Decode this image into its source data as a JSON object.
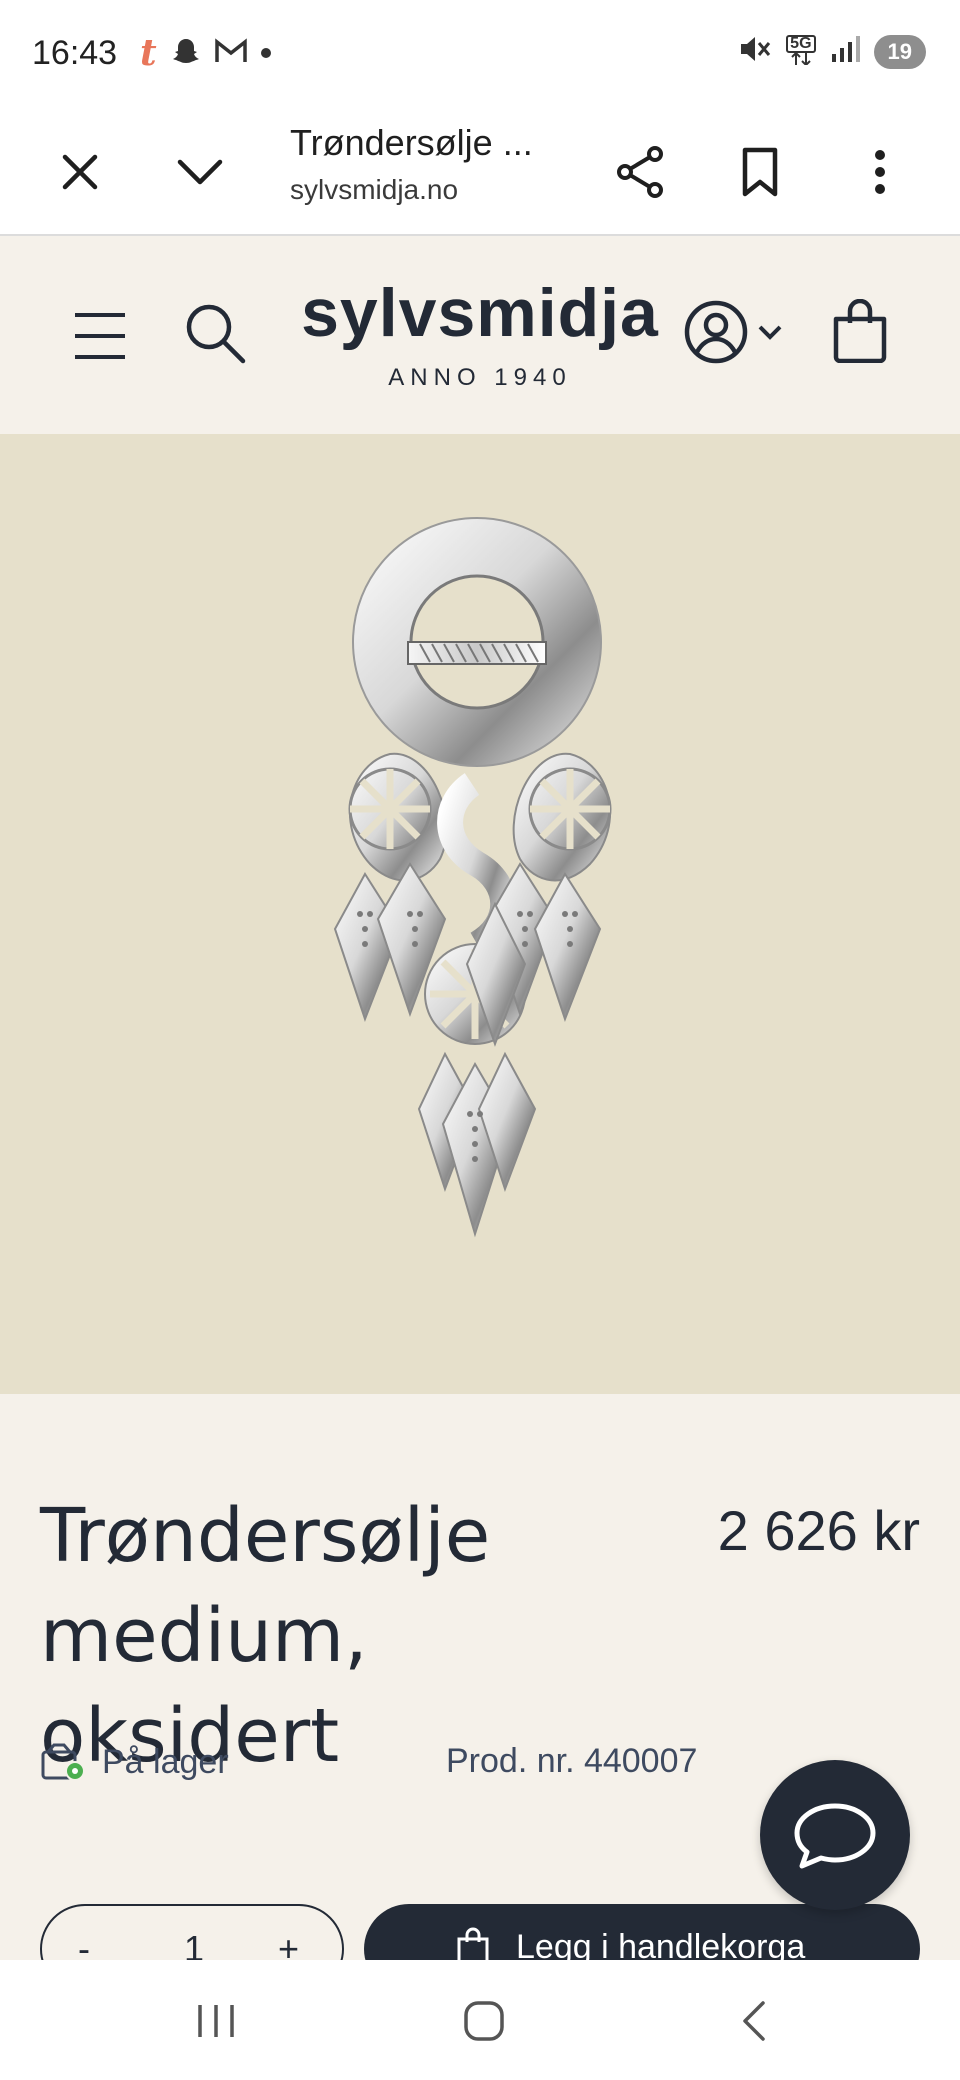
{
  "status_bar": {
    "time": "16:43",
    "left_icons": [
      "tumblr-icon",
      "snapchat-icon",
      "gmail-icon",
      "dot-icon"
    ],
    "right_icons": [
      "mute-icon",
      "5g-icon",
      "signal-icon"
    ],
    "network": "5G",
    "battery": "19"
  },
  "tab_bar": {
    "title": "Trøndersølje ...",
    "url": "sylvsmidja.no"
  },
  "header": {
    "logo": "sylvsmidja",
    "logo_sub": "ANNO 1940"
  },
  "product": {
    "image_alt": "Trøndersølje brooch",
    "title_line1": "Trøndersølje",
    "title_line2": "medium, oksidert",
    "price": "2 626 kr",
    "stock": "På lager",
    "stock_color": "#4caf50",
    "prod_nr": "Prod. nr. 440007",
    "quantity": "1",
    "minus": "-",
    "plus": "+",
    "add_to_cart": "Legg i handlekorga"
  },
  "colors": {
    "brand_dark": "#232a36",
    "header_bg": "#f5f1ea",
    "image_bg": "#e6e0cb"
  }
}
